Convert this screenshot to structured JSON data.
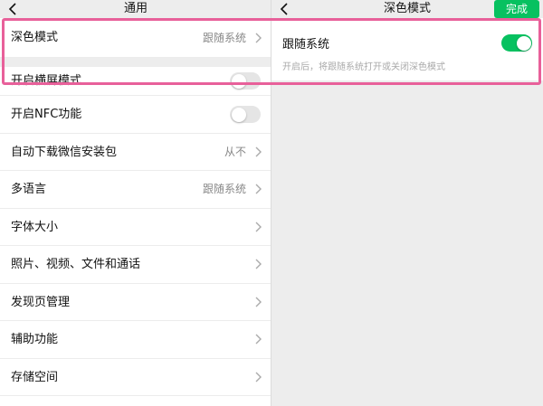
{
  "left": {
    "title": "通用",
    "rows": [
      {
        "label": "深色模式",
        "value": "跟随系统",
        "type": "nav"
      },
      {
        "label": "开启横屏模式",
        "type": "toggle",
        "on": false
      },
      {
        "label": "开启NFC功能",
        "type": "toggle",
        "on": false
      },
      {
        "label": "自动下载微信安装包",
        "value": "从不",
        "type": "nav"
      },
      {
        "label": "多语言",
        "value": "跟随系统",
        "type": "nav"
      },
      {
        "label": "字体大小",
        "value": "",
        "type": "nav"
      },
      {
        "label": "照片、视频、文件和通话",
        "value": "",
        "type": "nav"
      },
      {
        "label": "发现页管理",
        "value": "",
        "type": "nav"
      },
      {
        "label": "辅助功能",
        "value": "",
        "type": "nav"
      },
      {
        "label": "存储空间",
        "value": "",
        "type": "nav"
      }
    ]
  },
  "right": {
    "title": "深色模式",
    "done_label": "完成",
    "follow_system": {
      "label": "跟随系统",
      "description": "开启后，将跟随系统打开或关闭深色模式",
      "on": true
    }
  },
  "colors": {
    "accent": "#07c160",
    "highlight": "#e8609a",
    "background": "#ededed"
  },
  "icons": {
    "back": "chevron-left-icon",
    "row_arrow": "chevron-right-icon"
  }
}
